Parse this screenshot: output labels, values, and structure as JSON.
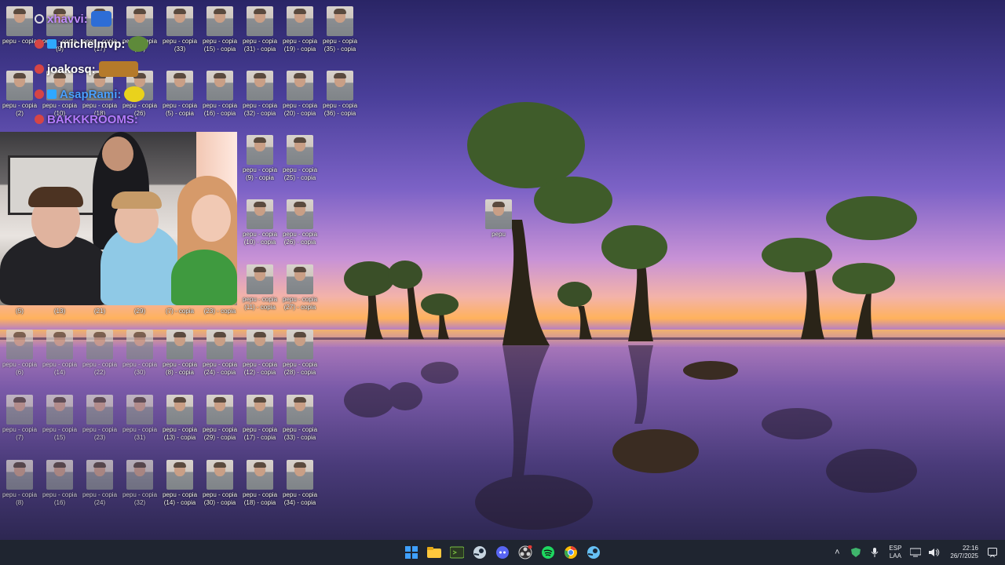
{
  "chat": [
    {
      "user": "xhavvi:",
      "color": "#c08cff"
    },
    {
      "user": "michelmvp:",
      "color": "#ffffff"
    },
    {
      "user": "joakosq:",
      "color": "#ffffff"
    },
    {
      "user": "AsapRami:",
      "color": "#4aa0ff"
    },
    {
      "user": "BAKKKROOMS:",
      "color": "#b47bff"
    }
  ],
  "desktop_icons": {
    "row0": [
      "pepu - copia",
      "pepu - copia\n(9)",
      "pepu - copia\n(17)",
      "pepu - copia\n(25)",
      "pepu - copia\n(33)",
      "pepu - copia\n(15) - copia",
      "pepu - copia\n(31) - copia",
      "pepu - copia\n(19) - copia",
      "pepu - copia\n(35) - copia"
    ],
    "row1": [
      "pepu - copia\n(2)",
      "pepu - copia\n(10)",
      "pepu - copia\n(18)",
      "pepu - copia\n(26)",
      "pepu - copia\n(5) - copia",
      "pepu - copia\n(16) - copia",
      "pepu - copia\n(32) - copia",
      "pepu - copia\n(20) - copia",
      "pepu - copia\n(36) - copia"
    ],
    "col_right_a": [
      "pepu - copia\n(9) - copia",
      "pepu - copia\n(10) - copia",
      "pepu - copia\n(11) - copia"
    ],
    "col_right_b": [
      "pepu - copia\n(25) - copia",
      "pepu - copia\n(26) - copia",
      "pepu - copia\n(27) - copia"
    ],
    "row_cam_bottom": [
      "(5)",
      "(13)",
      "(21)",
      "(29)",
      "(7) - copia",
      "(23) - copia",
      "(11) - copia",
      "(27) - copia"
    ],
    "row3": [
      "pepu - copia\n(6)",
      "pepu - copia\n(14)",
      "pepu - copia\n(22)",
      "pepu - copia\n(30)",
      "pepu - copia\n(8) - copia",
      "pepu - copia\n(24) - copia",
      "pepu - copia\n(12) - copia",
      "pepu - copia\n(28) - copia"
    ],
    "row4": [
      "pepu - copia\n(7)",
      "pepu - copia\n(15)",
      "pepu - copia\n(23)",
      "pepu - copia\n(31)",
      "pepu - copia\n(13) - copia",
      "pepu - copia\n(29) - copia",
      "pepu - copia\n(17) - copia",
      "pepu - copia\n(33) - copia"
    ],
    "row5": [
      "pepu - copia\n(8)",
      "pepu - copia\n(16)",
      "pepu - copia\n(24)",
      "pepu - copia\n(32)",
      "pepu - copia\n(14) - copia",
      "pepu - copia\n(30) - copia",
      "pepu - copia\n(18) - copia",
      "pepu - copia\n(34) - copia"
    ],
    "lone": "pepu"
  },
  "taskbar": {
    "apps": [
      {
        "name": "start-button-icon",
        "color": "#3fa0ff"
      },
      {
        "name": "file-explorer-icon",
        "color": "#ffc83d"
      },
      {
        "name": "terminal-icon",
        "color": "#7ac142"
      },
      {
        "name": "steam-icon",
        "color": "#c7d5e0"
      },
      {
        "name": "discord-icon",
        "color": "#5865f2"
      },
      {
        "name": "obs-icon",
        "color": "#d0d0d0"
      },
      {
        "name": "spotify-icon",
        "color": "#1ed760"
      },
      {
        "name": "chrome-icon",
        "color": "#fbbc05"
      },
      {
        "name": "steam-2-icon",
        "color": "#66c0f4"
      }
    ],
    "lang_top": "ESP",
    "lang_bottom": "LAA",
    "time": "22:16",
    "date": "26/7/2025"
  }
}
